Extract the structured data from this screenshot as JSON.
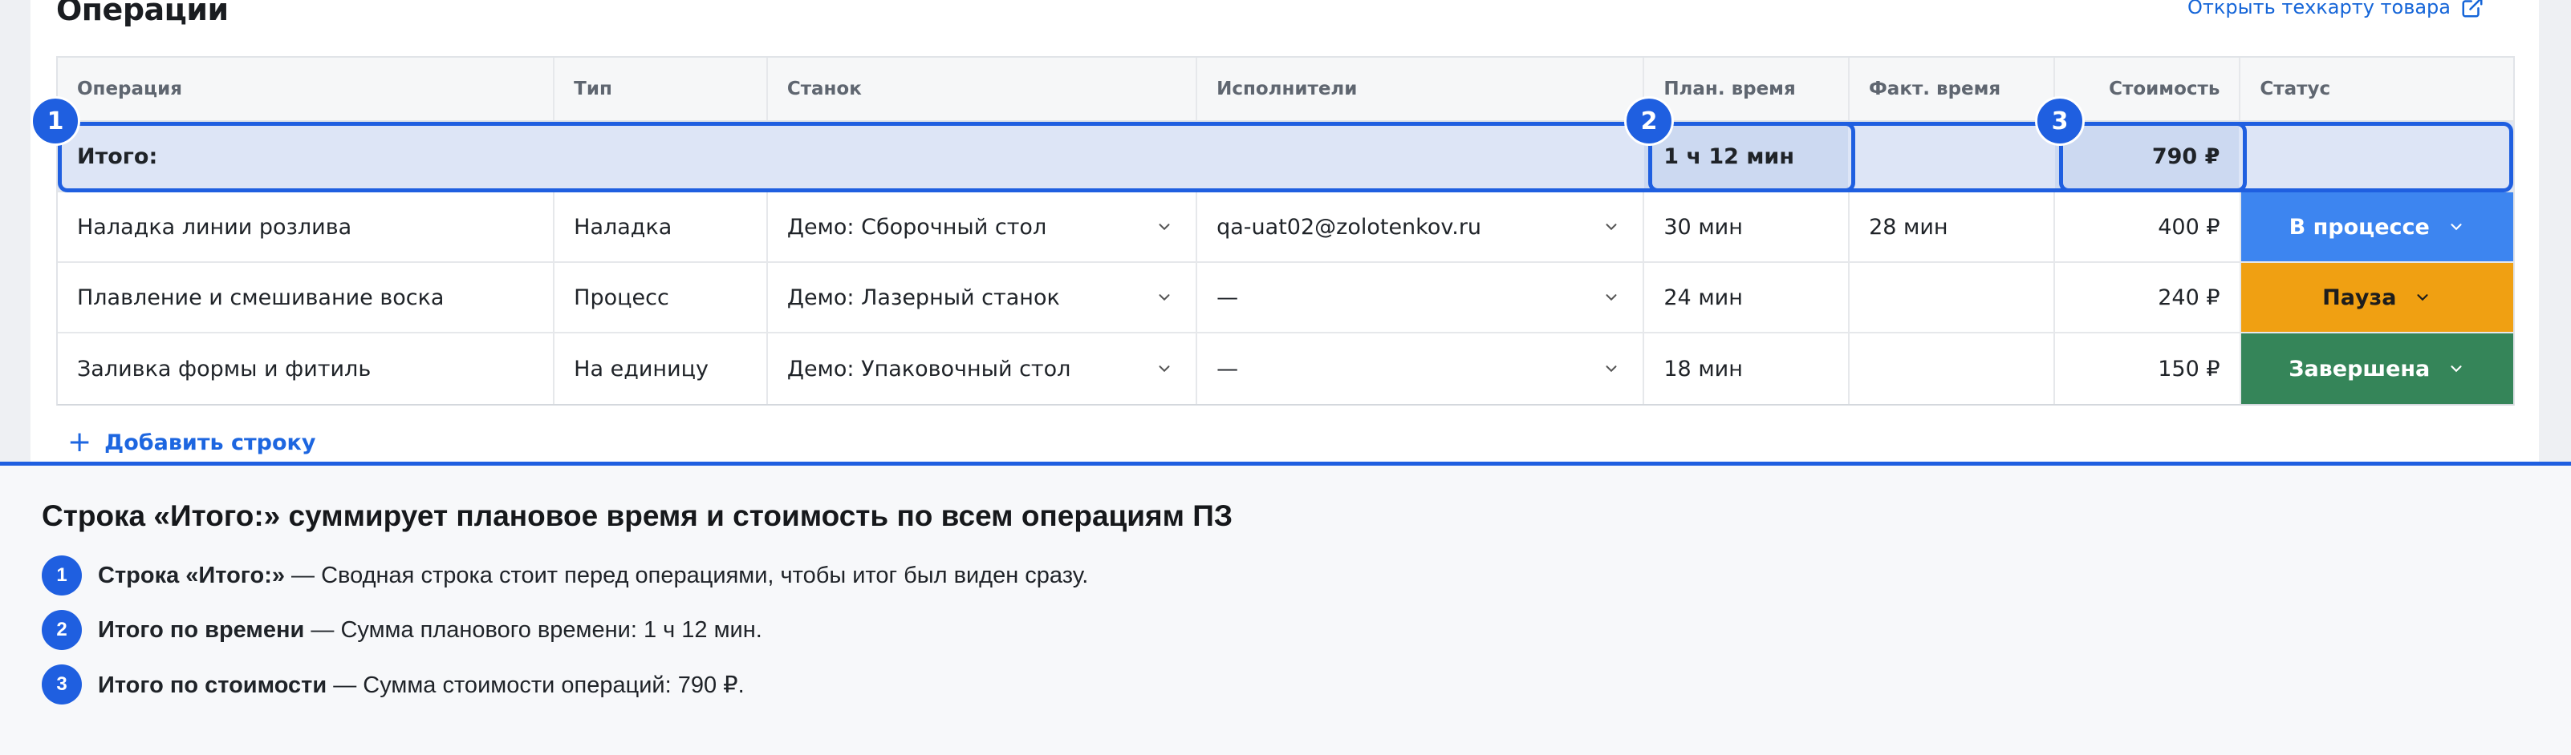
{
  "section": {
    "title": "Операции",
    "techcard_link": "Открыть техкарту товара"
  },
  "table": {
    "columns": [
      "Операция",
      "Тип",
      "Станок",
      "Исполнители",
      "План. время",
      "Факт. время",
      "Стоимость",
      "Статус"
    ],
    "total": {
      "label": "Итого:",
      "plan_time": "1 ч 12 мин",
      "cost": "790 ₽"
    },
    "rows": [
      {
        "operation": "Наладка линии розлива",
        "type": "Наладка",
        "machine": "Демо: Сборочный стол",
        "executor": "qa-uat02@zolotenkov.ru",
        "plan_time": "30 мин",
        "fact_time": "28 мин",
        "cost": "400 ₽",
        "status": "В процессе",
        "status_color": "#3d85f0"
      },
      {
        "operation": "Плавление и смешивание воска",
        "type": "Процесс",
        "machine": "Демо: Лазерный станок",
        "executor": "—",
        "plan_time": "24 мин",
        "fact_time": "",
        "cost": "240 ₽",
        "status": "Пауза",
        "status_color": "#f0a012"
      },
      {
        "operation": "Заливка формы и фитиль",
        "type": "На единицу",
        "machine": "Демо: Упаковочный стол",
        "executor": "—",
        "plan_time": "18 мин",
        "fact_time": "",
        "cost": "150 ₽",
        "status": "Завершена",
        "status_color": "#358559"
      }
    ],
    "add_row": "Добавить строку"
  },
  "badges": [
    "1",
    "2",
    "3"
  ],
  "explanation": {
    "title": "Строка «Итого:» суммирует плановое время и стоимость по всем операциям ПЗ",
    "notes": [
      {
        "num": "1",
        "term": "Строка «Итого:»",
        "text": " — Сводная строка стоит перед операциями, чтобы итог был виден сразу."
      },
      {
        "num": "2",
        "term": "Итого по времени",
        "text": " — Сумма планового времени: 1 ч 12 мин."
      },
      {
        "num": "3",
        "term": "Итого по стоимости",
        "text": " — Сумма стоимости операций: 790 ₽."
      }
    ]
  },
  "colors": {
    "accent": "#1f5fe0",
    "total_row_bg": "#dde5f6",
    "status_in_progress": "#3d85f0",
    "status_pause": "#f0a012",
    "status_done": "#358559"
  }
}
